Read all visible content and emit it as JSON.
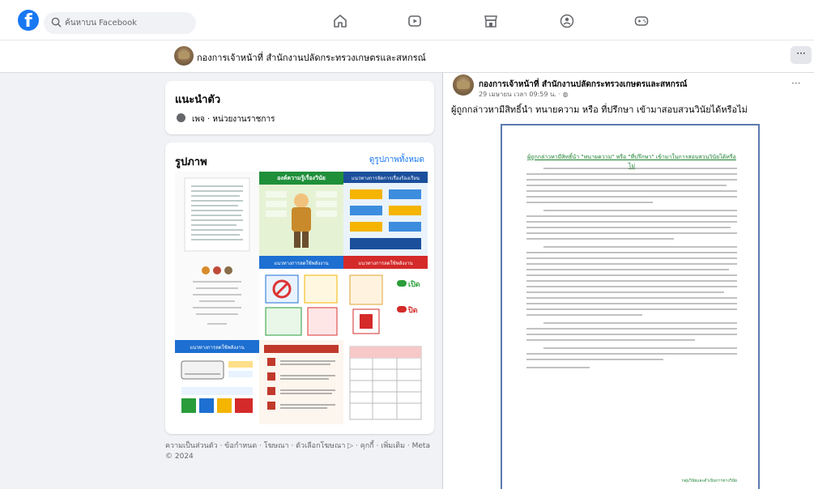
{
  "topnav": {
    "logo": "f",
    "search_placeholder": "ค้นหาบน Facebook"
  },
  "profile": {
    "name": "กองการเจ้าหน้าที่ สำนักงานปลัดกระทรวงเกษตรและสหกรณ์",
    "more": "···"
  },
  "intro": {
    "heading": "แนะนำตัว",
    "category": "เพจ · หน่วยงานราชการ"
  },
  "photos": {
    "heading": "รูปภาพ",
    "see_all": "ดูรูปภาพทั้งหมด",
    "items": [
      {
        "caption": ""
      },
      {
        "caption": "องค์ความรู้เรื่องวินัย"
      },
      {
        "caption": "แนวทางการจัดการเรื่องร้องเรียน"
      },
      {
        "caption": ""
      },
      {
        "caption": "แนวทางการลดใช้พลังงาน"
      },
      {
        "caption": "แนวทางการลดใช้พลังงาน"
      },
      {
        "caption": "แนวทางการลดใช้พลังงาน"
      },
      {
        "caption": ""
      },
      {
        "caption": ""
      }
    ],
    "power_on": "เปิด",
    "power_off": "ปิด"
  },
  "footer": {
    "text": "ความเป็นส่วนตัว · ข้อกำหนด · โฆษณา · ตัวเลือกโฆษณา ▷ · คุกกี้ · เพิ่มเติม · Meta © 2024"
  },
  "post": {
    "author": "กองการเจ้าหน้าที่ สำนักงานปลัดกระทรวงเกษตรและสหกรณ์",
    "time": "29 เมษายน เวลา 09:59 น. · ◍",
    "more": "···",
    "text": "ผู้ถูกกล่าวหามีสิทธิ์นำ ทนายความ หรือ ที่ปรึกษา เข้ามาสอบสวนวินัยได้หรือไม่",
    "doc_title": "ผู้ถูกกล่าวหามีสิทธิ์นำ \"ทนายความ\" หรือ \"ที่ปรึกษา\" เข้ามาในการสอบสวนวินัยได้หรือไม่",
    "doc_sign": "กลุ่มวินัยและดำเนินการทางวินัย"
  },
  "colors": {
    "brand": "#1877f2",
    "doc_title": "#1a7f2c",
    "doc_border": "#5c7ab0"
  }
}
